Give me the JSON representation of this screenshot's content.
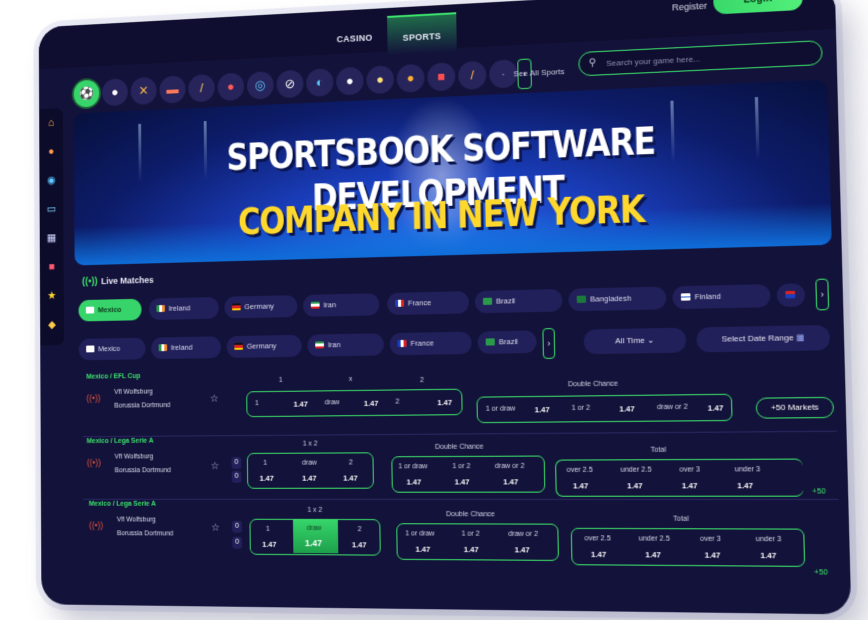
{
  "colors": {
    "accent": "#3ce26b",
    "background": "#13123a",
    "banner_title": "#ffffff",
    "banner_subtitle": "#ffd82e"
  },
  "topbar": {
    "tabs": [
      "CASINO",
      "SPORTS"
    ],
    "register": "Register",
    "login": "Login"
  },
  "sidebar": {
    "icons": [
      "home-icon",
      "bell-icon",
      "palette-icon",
      "card-icon",
      "calculator-icon",
      "gift-icon",
      "star-icon",
      "shield-icon"
    ]
  },
  "sports": {
    "icons": [
      "soccer-icon",
      "ball-icon",
      "hockey-icon",
      "bench-icon",
      "baseball-icon",
      "table-tennis-icon",
      "darts-icon",
      "tennis-icon",
      "volleyball-icon",
      "golf-icon",
      "badminton-icon",
      "basketball-icon",
      "boxing-icon",
      "cricket-icon",
      "more-icon"
    ],
    "see_all": "See All Sports",
    "search_placeholder": "Search your game here..."
  },
  "banner": {
    "line1": "SPORTSBOOK SOFTWARE DEVELOPMENT",
    "line2": "COMPANY IN NEW YORK"
  },
  "live": {
    "title": "Live Matches",
    "row1": [
      "Mexico",
      "Ireland",
      "Germany",
      "Iran",
      "France",
      "Brazil",
      "Bangladesh",
      "Finland"
    ],
    "row2": [
      "Mexico",
      "Ireland",
      "Germany",
      "Iran",
      "France",
      "Brazil"
    ],
    "filter": "All Time",
    "date_range": "Select Date Range"
  },
  "matches": [
    {
      "league": "Mexico / EFL Cup",
      "home": "Vfl Wolfsburg",
      "away": "Borussia Dortmund",
      "main_headers": [
        "1",
        "x",
        "2"
      ],
      "main_labels": [
        "1",
        "draw",
        "2"
      ],
      "main_values": [
        "1.47",
        "1.47",
        "1.47"
      ],
      "dc_header": "Double Chance",
      "dc_labels": [
        "1 or draw",
        "1 or 2",
        "draw or 2"
      ],
      "dc_values": [
        "1.47",
        "1.47",
        "1.47"
      ],
      "markets": "+50 Markets"
    },
    {
      "league": "Mexico / Lega Serie A",
      "home": "Vfl Wolfsburg",
      "away": "Borussia Dortmund",
      "scores": [
        "0",
        "0"
      ],
      "main_header": "1 x 2",
      "main_labels": [
        "1",
        "draw",
        "2"
      ],
      "main_values": [
        "1.47",
        "1.47",
        "1.47"
      ],
      "dc_header": "Double Chance",
      "dc_labels": [
        "1 or draw",
        "1 or 2",
        "draw or 2"
      ],
      "dc_values": [
        "1.47",
        "1.47",
        "1.47"
      ],
      "total_header": "Total",
      "total_labels": [
        "over 2.5",
        "under 2.5",
        "over 3",
        "under 3"
      ],
      "total_values": [
        "1.47",
        "1.47",
        "1.47",
        "1.47"
      ],
      "plus": "+50"
    },
    {
      "league": "Mexico / Lega Serie A",
      "home": "Vfl Wolfsburg",
      "away": "Borussia Dortmund",
      "scores": [
        "0",
        "0"
      ],
      "main_header": "1 x 2",
      "main_labels": [
        "1",
        "draw",
        "2"
      ],
      "main_values": [
        "1.47",
        "1.47",
        "1.47"
      ],
      "dc_header": "Double Chance",
      "dc_labels": [
        "1 or draw",
        "1 or 2",
        "draw or 2"
      ],
      "dc_values": [
        "1.47",
        "1.47",
        "1.47"
      ],
      "total_header": "Total",
      "total_labels": [
        "over 2.5",
        "under 2.5",
        "over 3",
        "under 3"
      ],
      "total_values": [
        "1.47",
        "1.47",
        "1.47",
        "1.47"
      ],
      "plus": "+50"
    }
  ]
}
